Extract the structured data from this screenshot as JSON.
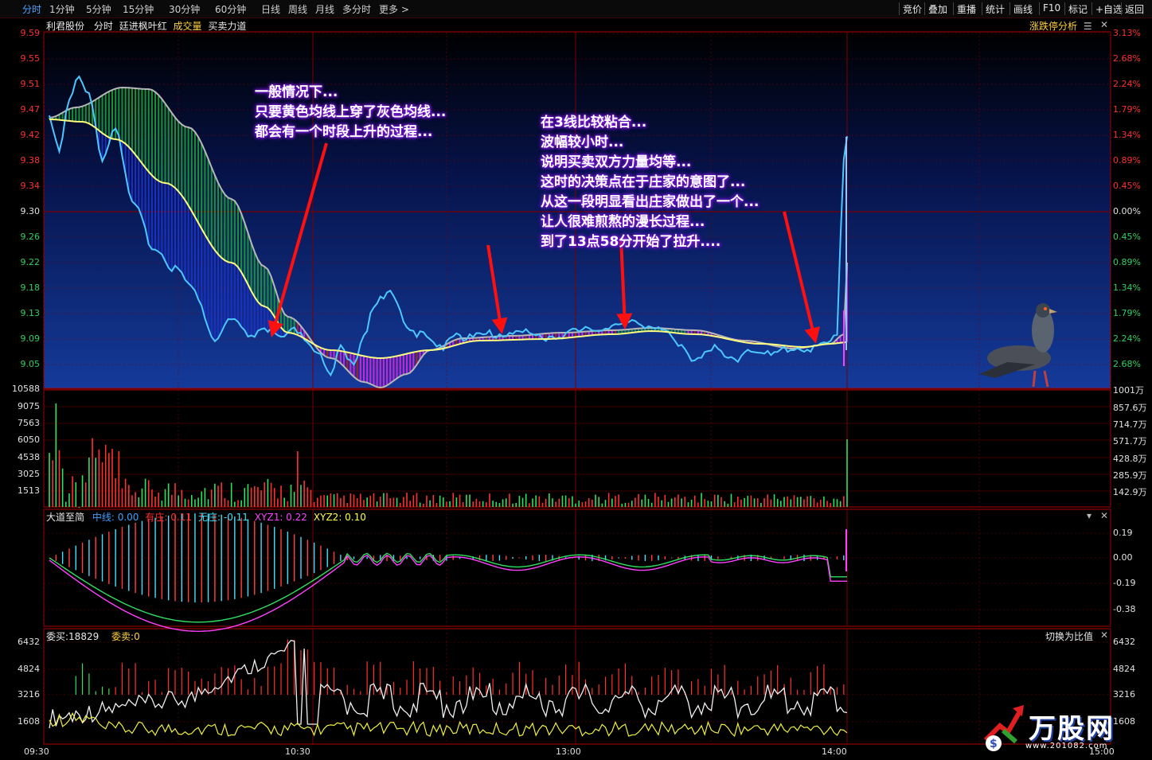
{
  "toolbar": {
    "periods": [
      "分时",
      "1分钟",
      "5分钟",
      "15分钟",
      "30分钟",
      "60分钟",
      "日线",
      "周线",
      "月线",
      "多分时",
      "更多 >"
    ],
    "active_period": "分时",
    "tools": [
      "竞价",
      "叠加",
      "重播",
      "统计",
      "画线",
      "F10",
      "标记",
      "+自选",
      "返回"
    ]
  },
  "stock_header": {
    "name": "利君股份",
    "mode": "分时",
    "indicators": [
      "廷进枫叶红",
      "成交量",
      "买卖力道"
    ],
    "right_label": "涨跌停分析"
  },
  "price_axis": {
    "left": [
      "9.59",
      "9.55",
      "9.51",
      "9.47",
      "9.42",
      "9.38",
      "9.34",
      "9.30",
      "9.26",
      "9.22",
      "9.18",
      "9.13",
      "9.09",
      "9.05"
    ],
    "right": [
      "3.13%",
      "2.68%",
      "2.24%",
      "1.79%",
      "1.34%",
      "0.89%",
      "0.45%",
      "0.00%",
      "0.45%",
      "0.89%",
      "1.34%",
      "1.79%",
      "2.24%",
      "2.68%"
    ]
  },
  "volume_axis": {
    "left": [
      "10588",
      "9075",
      "7563",
      "6050",
      "4538",
      "3025",
      "1513"
    ],
    "right": [
      "1001万",
      "857.6万",
      "714.7万",
      "571.7万",
      "428.8万",
      "285.9万",
      "142.9万"
    ]
  },
  "indicator_panel": {
    "title": "大道至简",
    "items": [
      {
        "label": "中线",
        "value": "0.00",
        "color": "#3aa0ff"
      },
      {
        "label": "有庄",
        "value": "0.11",
        "color": "#ff3030"
      },
      {
        "label": "无庄",
        "value": "-0.11",
        "color": "#40e0ff"
      },
      {
        "label": "XYZ1",
        "value": "0.22",
        "color": "#ff40ff"
      },
      {
        "label": "XYZ2",
        "value": "0.10",
        "color": "#ffff40"
      }
    ],
    "axis_right": [
      "0.19",
      "0.00",
      "-0.19",
      "-0.38"
    ]
  },
  "order_panel": {
    "buy_label": "委买:18829",
    "sell_label": "委卖:0",
    "switch_label": "切换为比值",
    "axis_left": [
      "6432",
      "4824",
      "3216",
      "1608"
    ],
    "axis_right": [
      "6432",
      "4824",
      "3216",
      "1608"
    ]
  },
  "time_axis": [
    "09:30",
    "10:30",
    "13:00",
    "14:00",
    "15:00"
  ],
  "annotations": {
    "left": [
      "一般情况下...",
      "只要黄色均线上穿了灰色均线...",
      "都会有一个时段上升的过程..."
    ],
    "right": [
      "在3线比较粘合...",
      "波幅较小时...",
      "说明买卖双方力量均等...",
      "这时的决策点在于庄家的意图了...",
      "从这一段明显看出庄家做出了一个...",
      "让人很难煎熬的漫长过程...",
      "到了13点58分开始了拉升...."
    ]
  },
  "logo": {
    "text": "万股网",
    "url": "www.201082.com"
  },
  "colors": {
    "up": "#ff3232",
    "down": "#00d060",
    "price_line": "#4cc8ff",
    "avg_line": "#ffff80",
    "grid": "#7a0000",
    "accent": "#4fa3ff"
  },
  "chart_data": {
    "type": "line",
    "title": "利君股份 分时",
    "prev_close": 9.3,
    "ylim": [
      9.01,
      9.59
    ],
    "series": [
      {
        "name": "分时",
        "x": [
          "09:30",
          "09:35",
          "09:40",
          "09:50",
          "10:00",
          "10:10",
          "10:20",
          "10:30",
          "10:45",
          "11:00",
          "11:15",
          "11:30",
          "13:00",
          "13:20",
          "13:40",
          "13:58",
          "14:00",
          "14:05"
        ],
        "values": [
          9.46,
          9.51,
          9.43,
          9.24,
          9.13,
          9.1,
          9.1,
          9.05,
          9.08,
          9.12,
          9.08,
          9.09,
          9.1,
          9.06,
          9.05,
          9.08,
          9.1,
          9.44
        ]
      },
      {
        "name": "均线",
        "x": [
          "09:30",
          "09:40",
          "09:50",
          "10:00",
          "10:10",
          "10:20",
          "10:30",
          "10:45",
          "11:00",
          "11:30",
          "13:00",
          "13:40",
          "14:00",
          "14:05"
        ],
        "values": [
          9.45,
          9.42,
          9.34,
          9.24,
          9.15,
          9.1,
          9.07,
          9.06,
          9.07,
          9.09,
          9.1,
          9.08,
          9.08,
          9.09
        ]
      }
    ]
  }
}
